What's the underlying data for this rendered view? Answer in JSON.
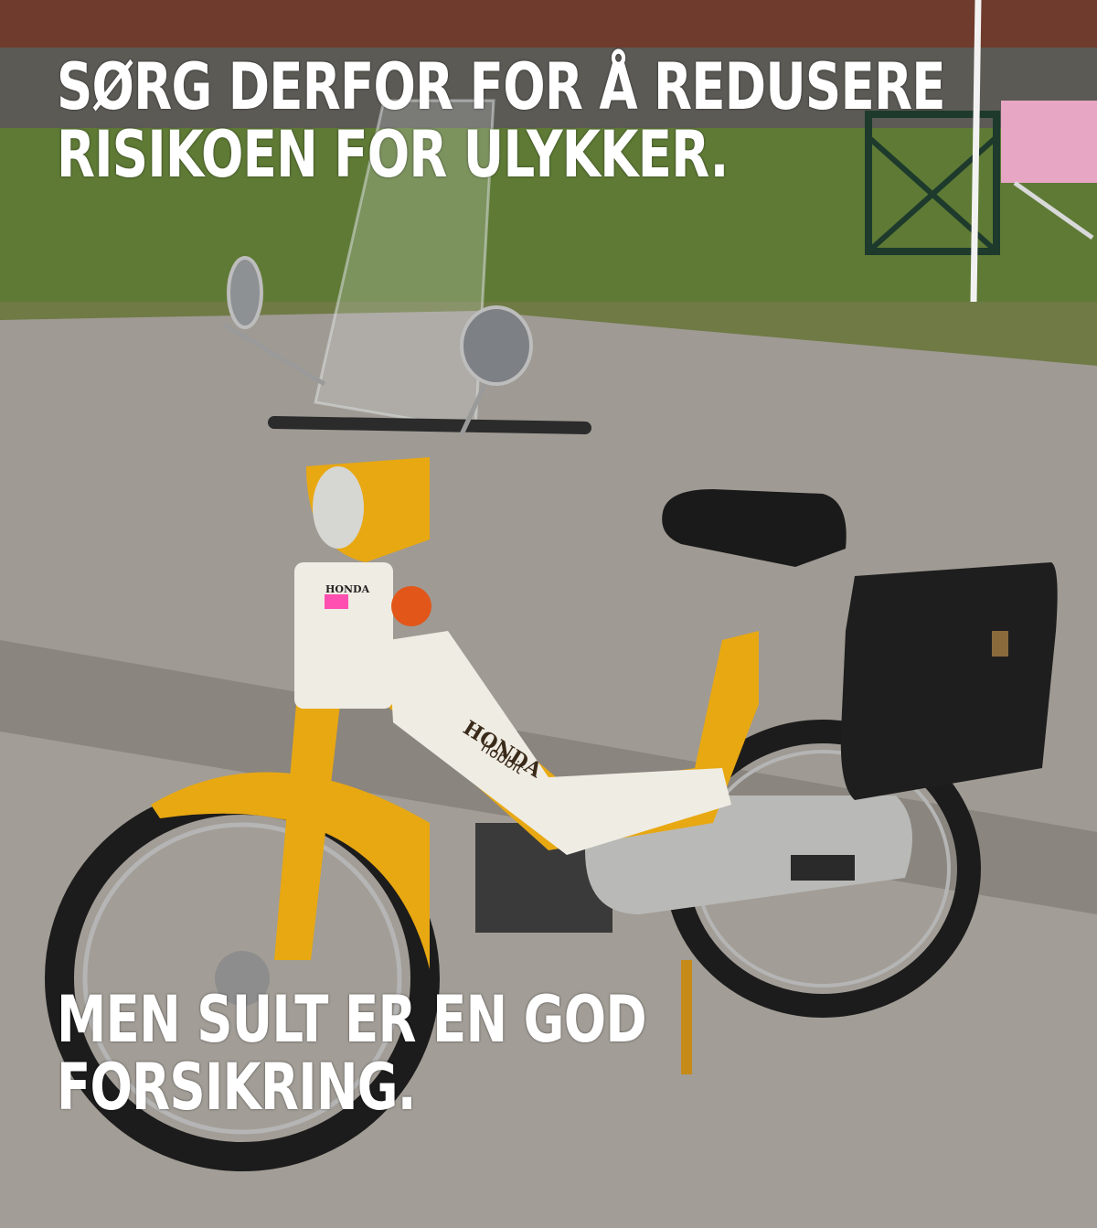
{
  "meme": {
    "top_text": [
      "SØRG DERFOR FOR Å REDUSERE",
      "RISIKOEN FOR ULYKKER."
    ],
    "bottom_text": [
      "MEN SULT ER EN GOD",
      "FORSIKRING."
    ]
  },
  "scene": {
    "subject": "yellow-and-white moped with black saddle bag",
    "background": [
      "brick wall",
      "grass",
      "folding chairs",
      "sidewalk",
      "curb",
      "road"
    ],
    "logo_text": [
      "HONDA",
      "hobbit"
    ],
    "colors": {
      "frame": "#e8a812",
      "panel": "#efece3",
      "seat": "#1a1a1a",
      "pavement": "#9b968f",
      "grass": "#5e7a35",
      "brick": "#6e3b2c"
    }
  }
}
